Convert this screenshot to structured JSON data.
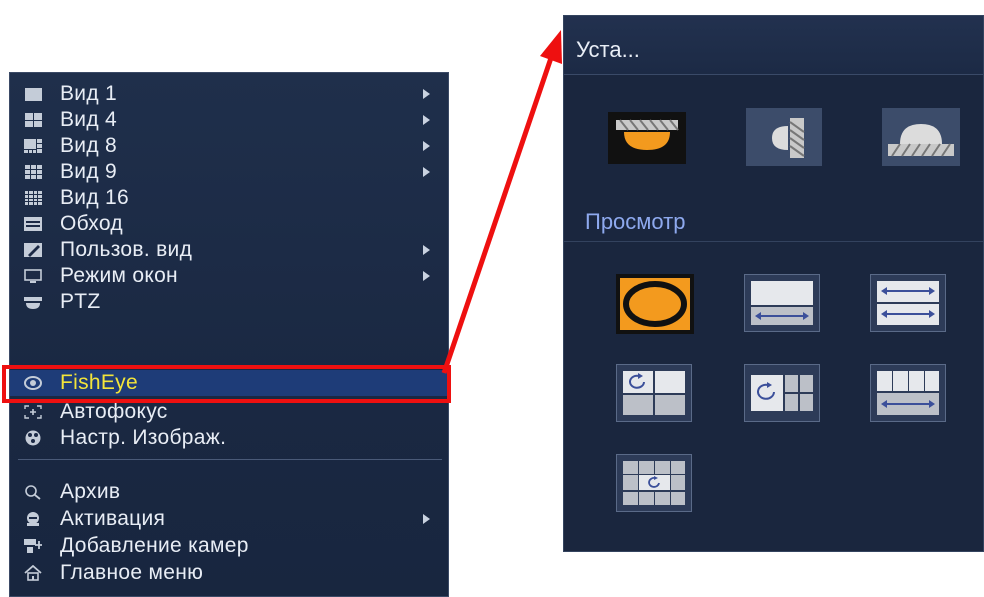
{
  "menu": {
    "items": [
      {
        "label": "Вид 1",
        "icon": "single-view-icon",
        "submenu": true
      },
      {
        "label": "Вид 4",
        "icon": "grid-4-icon",
        "submenu": true
      },
      {
        "label": "Вид 8",
        "icon": "grid-8-icon",
        "submenu": true
      },
      {
        "label": "Вид 9",
        "icon": "grid-9-icon",
        "submenu": true
      },
      {
        "label": "Вид 16",
        "icon": "grid-16-icon",
        "submenu": false
      },
      {
        "label": "Обход",
        "icon": "tour-icon",
        "submenu": false
      },
      {
        "label": "Пользов. вид",
        "icon": "custom-view-icon",
        "submenu": true
      },
      {
        "label": "Режим окон",
        "icon": "monitor-icon",
        "submenu": true
      },
      {
        "label": "PTZ",
        "icon": "ptz-icon",
        "submenu": false
      },
      {
        "label": "FishEye",
        "icon": "fisheye-icon",
        "submenu": false,
        "selected": true
      },
      {
        "label": "Автофокус",
        "icon": "autofocus-icon",
        "submenu": false
      },
      {
        "label": "Настр. Изображ.",
        "icon": "image-settings-icon",
        "submenu": false
      },
      {
        "label": "Архив",
        "icon": "search-icon",
        "submenu": false
      },
      {
        "label": "Активация",
        "icon": "activation-icon",
        "submenu": true
      },
      {
        "label": "Добавление камер",
        "icon": "add-camera-icon",
        "submenu": false
      },
      {
        "label": "Главное меню",
        "icon": "home-icon",
        "submenu": false
      }
    ]
  },
  "panel": {
    "title": "Уста...",
    "preview_label": "Просмотр",
    "mount_options": [
      "ceiling-mount-icon",
      "wall-mount-icon",
      "ground-mount-icon"
    ],
    "view_modes": [
      "fisheye-original-icon",
      "panorama-1-icon",
      "panorama-2-icon",
      "fisheye-1p3-icon",
      "fisheye-1p4-icon",
      "panorama-1p4-icon",
      "fisheye-1p8-icon"
    ],
    "selected_mount": "ceiling-mount-icon",
    "selected_view": "fisheye-original-icon"
  },
  "colors": {
    "menu_bg": "#1b2945",
    "selected_text": "#f3e53a",
    "selected_row": "#1e3c78",
    "highlight": "#ee1010",
    "section_label": "#8ea9ee",
    "accent_orange": "#f39a1e"
  }
}
